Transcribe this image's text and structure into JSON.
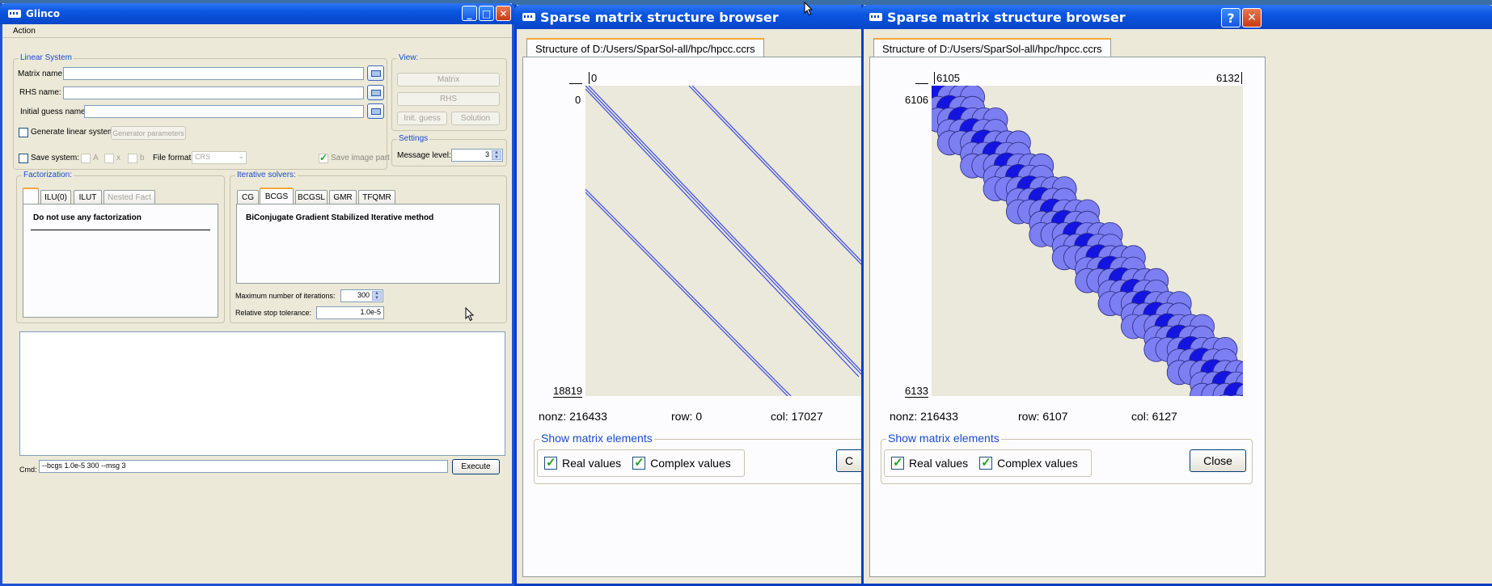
{
  "glinco": {
    "title": "Glinco",
    "menu": [
      "Action"
    ],
    "linear_system": {
      "legend": "Linear System",
      "matrix_label": "Matrix name:",
      "rhs_label": "RHS name:",
      "initial_label": "Initial guess name:",
      "matrix_value": "",
      "rhs_value": "",
      "initial_value": "",
      "generate_label": "Generate linear system",
      "generator_button": "Generator parameters",
      "save_label": "Save system:",
      "a_label": "A",
      "x_label": "x",
      "b_label": "b",
      "file_format_label": "File format:",
      "file_format_value": "CRS",
      "save_image_label": "Save image part"
    },
    "view": {
      "legend": "View:",
      "matrix": "Matrix",
      "rhs": "RHS",
      "init_guess": "Init. guess",
      "solution": "Solution"
    },
    "settings": {
      "legend": "Settings",
      "message_level_label": "Message level:",
      "message_level_value": "3"
    },
    "factorization": {
      "legend": "Factorization:",
      "tabs": [
        "ILU(0)",
        "ILUT",
        "Nested Fact"
      ],
      "content": "Do not use any factorization"
    },
    "iterative": {
      "legend": "Iterative solvers:",
      "tabs": [
        "CG",
        "BCGS",
        "BCGSL",
        "GMR",
        "TFQMR"
      ],
      "content": "BiConjugate Gradient Stabilized Iterative method",
      "max_iter_label": "Maximum number of  iterations:",
      "max_iter_value": "300",
      "tolerance_label": "Relative stop tolerance:",
      "tolerance_value": "1.0e-5"
    },
    "output": "",
    "cmd_label": "Cmd:",
    "cmd_value": "--bcgs 1.0e-5 300 --msg 3",
    "execute": "Execute"
  },
  "browser1": {
    "title": "Sparse matrix structure browser",
    "tab": "Structure of D:/Users/SparSol-all/hpc/hpcc.ccrs",
    "x_start": "0",
    "y_start": "0",
    "y_end": "18819",
    "nonz": "nonz: 216433",
    "row": "row: 0",
    "col": "col: 17027",
    "show_legend": "Show matrix elements",
    "real": "Real values",
    "complex": "Complex values",
    "close_partial": "C"
  },
  "browser2": {
    "title": "Sparse matrix structure browser",
    "tab": "Structure of D:/Users/SparSol-all/hpc/hpcc.ccrs",
    "x_start": "6105",
    "x_end": "6132",
    "y_start": "6106",
    "y_end": "6133",
    "nonz": "nonz: 216433",
    "row": "row: 6107",
    "col": "col: 6127",
    "show_legend": "Show matrix elements",
    "real": "Real values",
    "complex": "Complex values",
    "close": "Close",
    "help": "?"
  },
  "colors": {
    "titlebar": "#0a55e0",
    "matrix_line": "#3a4bdc",
    "bubble_light": "#7b7ff2",
    "bubble_dark": "#1414e0"
  }
}
